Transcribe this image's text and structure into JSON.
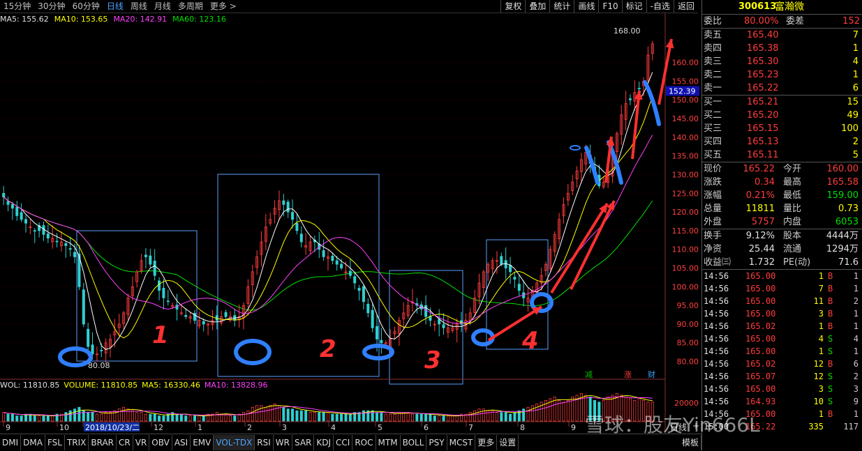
{
  "toolbar": {
    "periods": [
      "15分钟",
      "30分钟",
      "60分钟",
      "日线",
      "周线",
      "月线",
      "多周期",
      "更多 >"
    ],
    "active_period": "日线",
    "buttons": [
      "复权",
      "叠加",
      "统计",
      "画线",
      "F10",
      "标记",
      "-自选",
      "返回"
    ]
  },
  "ma_legend": {
    "ma5": "MA5: 155.62",
    "ma10": "MA10: 153.65",
    "ma20": "MA20: 142.91",
    "ma60": "MA60: 123.16"
  },
  "colors": {
    "up": "#ff3c3c",
    "down": "#30d0d0",
    "ma5": "#ffffff",
    "ma10": "#ffff00",
    "ma20": "#ff40ff",
    "ma60": "#00e000",
    "box": "#5aa0ff",
    "annotation_blue": "#2f7fff",
    "annotation_red": "#ff3030"
  },
  "chart_data": {
    "type": "candlestick",
    "ylim": [
      76,
      170
    ],
    "y_ticks": [
      80,
      85,
      90,
      95,
      100,
      105,
      110,
      115,
      120,
      125,
      130,
      135,
      140,
      145,
      150,
      155,
      160
    ],
    "price_marker": "152.39",
    "high_label": "168.00",
    "low_label": "80.08",
    "x_month_labels": [
      "9",
      "10",
      "2018/10/23/二",
      "12",
      "1",
      "2",
      "3",
      "4",
      "5",
      "6",
      "7",
      "8",
      "9"
    ],
    "close_path": [
      124,
      122,
      121,
      119,
      118,
      117,
      116,
      115,
      115,
      114,
      113,
      113,
      112,
      112,
      111,
      110,
      108,
      100,
      90,
      84,
      82,
      82,
      83,
      85,
      86,
      88,
      90,
      93,
      97,
      100,
      104,
      107,
      108,
      106,
      103,
      99,
      97,
      96,
      95,
      94,
      93,
      92,
      92,
      91,
      91,
      90,
      90,
      91,
      91,
      92,
      92,
      92,
      91,
      92,
      95,
      100,
      104,
      108,
      112,
      116,
      118,
      121,
      123,
      122,
      120,
      118,
      115,
      112,
      111,
      112,
      112,
      110,
      108,
      108,
      107,
      106,
      105,
      104,
      103,
      101,
      99,
      96,
      93,
      89,
      86,
      85,
      85,
      86,
      88,
      91,
      93,
      95,
      96,
      95,
      94,
      92,
      91,
      90,
      90,
      89,
      89,
      89,
      90,
      90,
      91,
      93,
      97,
      101,
      104,
      106,
      107,
      107,
      106,
      105,
      104,
      102,
      99,
      97,
      97,
      99,
      101,
      103,
      106,
      110,
      114,
      118,
      122,
      125,
      128,
      131,
      134,
      136,
      133,
      130,
      127,
      128,
      131,
      136,
      141,
      146,
      149,
      150,
      152,
      153,
      155,
      162,
      165
    ],
    "box_labels": [
      "1",
      "2",
      "3",
      "4"
    ],
    "volume": {
      "legend_wol": "WOL: 11810.85",
      "legend_volume": "VOLUME: 11810.85",
      "legend_ma5": "MA5: 16330.46",
      "legend_ma10": "MA10: 13828.96",
      "tick_label": "20000",
      "bars": [
        5,
        4,
        4,
        3,
        3,
        4,
        4,
        3,
        3,
        3,
        3,
        3,
        4,
        4,
        5,
        6,
        7,
        8,
        6,
        5,
        5,
        4,
        4,
        5,
        5,
        6,
        7,
        8,
        7,
        6,
        5,
        5,
        4,
        4,
        4,
        3,
        3,
        4,
        5,
        4,
        4,
        3,
        3,
        3,
        3,
        3,
        4,
        4,
        5,
        4,
        4,
        3,
        3,
        4,
        5,
        6,
        8,
        9,
        9,
        8,
        9,
        10,
        9,
        8,
        7,
        7,
        6,
        6,
        6,
        5,
        5,
        5,
        5,
        5,
        4,
        4,
        4,
        4,
        4,
        5,
        5,
        6,
        6,
        6,
        5,
        5,
        4,
        4,
        4,
        5,
        5,
        5,
        4,
        4,
        4,
        4,
        4,
        3,
        3,
        3,
        3,
        3,
        3,
        4,
        4,
        5,
        6,
        7,
        7,
        6,
        6,
        5,
        5,
        5,
        4,
        5,
        6,
        7,
        8,
        9,
        10,
        11,
        12,
        13,
        14,
        12,
        11,
        12,
        14,
        15,
        16,
        15,
        14,
        12,
        11,
        12,
        14,
        15,
        16,
        15,
        14,
        13,
        12,
        13,
        12,
        11,
        11
      ]
    },
    "markers": [
      "减",
      "涨",
      "财"
    ]
  },
  "indicator_tabs": [
    "DMI",
    "DMA",
    "FSL",
    "TRIX",
    "BRAR",
    "CR",
    "VR",
    "OBV",
    "ASI",
    "EMV",
    "VOL-TDX",
    "RSI",
    "WR",
    "SAR",
    "KDJ",
    "CCI",
    "ROC",
    "MTM",
    "BOLL",
    "PSY",
    "MCST",
    "更多",
    "设置"
  ],
  "active_tab": "VOL-TDX",
  "template_tab": "模板",
  "stock": {
    "code": "300613",
    "name": "富瀚微"
  },
  "order_book": {
    "weibi_label": "委比",
    "weibi_value": "80.00%",
    "weicha_label": "委差",
    "weicha_value": "152",
    "sells": [
      {
        "label": "卖五",
        "price": "165.40",
        "vol": "7"
      },
      {
        "label": "卖四",
        "price": "165.38",
        "vol": "1"
      },
      {
        "label": "卖三",
        "price": "165.30",
        "vol": "4"
      },
      {
        "label": "卖二",
        "price": "165.23",
        "vol": "1"
      },
      {
        "label": "卖一",
        "price": "165.22",
        "vol": "6"
      }
    ],
    "buys": [
      {
        "label": "买一",
        "price": "165.21",
        "vol": "15"
      },
      {
        "label": "买二",
        "price": "165.20",
        "vol": "49"
      },
      {
        "label": "买三",
        "price": "165.15",
        "vol": "100"
      },
      {
        "label": "买四",
        "price": "165.13",
        "vol": "2"
      },
      {
        "label": "买五",
        "price": "165.11",
        "vol": "5"
      }
    ]
  },
  "quote": [
    {
      "l1": "现价",
      "v1": "165.22",
      "l2": "今开",
      "v2": "160.00"
    },
    {
      "l1": "涨跌",
      "v1": "0.34",
      "l2": "最高",
      "v2": "165.58"
    },
    {
      "l1": "涨幅",
      "v1": "0.21%",
      "l2": "最低",
      "v2": "159.00"
    },
    {
      "l1": "总量",
      "v1": "11811",
      "l2": "量比",
      "v2": "0.73"
    },
    {
      "l1": "外盘",
      "v1": "5757",
      "l2": "内盘",
      "v2": "6053"
    }
  ],
  "stats": [
    {
      "l1": "换手",
      "v1": "9.12%",
      "l2": "股本",
      "v2": "4444万"
    },
    {
      "l1": "净资",
      "v1": "25.44",
      "l2": "流通",
      "v2": "1294万"
    },
    {
      "l1": "收益㈢",
      "v1": "1.732",
      "l2": "PE(动)",
      "v2": "71.6"
    }
  ],
  "ticks": [
    {
      "time": "14:56",
      "price": "165.00",
      "vol": "1",
      "side": "B",
      "n": "1"
    },
    {
      "time": "14:56",
      "price": "165.00",
      "vol": "7",
      "side": "B",
      "n": "1"
    },
    {
      "time": "14:56",
      "price": "165.00",
      "vol": "11",
      "side": "B",
      "n": "2"
    },
    {
      "time": "14:56",
      "price": "165.00",
      "vol": "3",
      "side": "B",
      "n": "1"
    },
    {
      "time": "14:56",
      "price": "165.02",
      "vol": "1",
      "side": "B",
      "n": "1"
    },
    {
      "time": "14:56",
      "price": "165.00",
      "vol": "4",
      "side": "S",
      "n": "4"
    },
    {
      "time": "14:56",
      "price": "165.00",
      "vol": "1",
      "side": "S",
      "n": "1"
    },
    {
      "time": "14:56",
      "price": "165.02",
      "vol": "12",
      "side": "B",
      "n": "6"
    },
    {
      "time": "14:56",
      "price": "165.07",
      "vol": "12",
      "side": "S",
      "n": "2"
    },
    {
      "time": "14:56",
      "price": "165.00",
      "vol": "3",
      "side": "S",
      "n": "3"
    },
    {
      "time": "14:56",
      "price": "164.93",
      "vol": "10",
      "side": "S",
      "n": "9"
    },
    {
      "time": "14:56",
      "price": "165.00",
      "vol": "1",
      "side": "B",
      "n": "1"
    },
    {
      "time": "15:00",
      "price": "165.22",
      "vol": "335",
      "side": "",
      "n": "117"
    }
  ],
  "watermark": "雪球：股友Yin666L",
  "side_tabs": [
    "日线",
    "+",
    "−"
  ]
}
